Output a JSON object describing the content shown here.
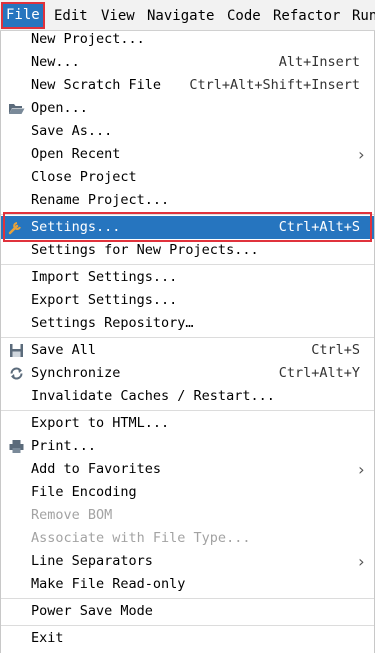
{
  "menubar": {
    "items": [
      {
        "label": "File",
        "mnemonic": "F",
        "active": true
      },
      {
        "label": "Edit"
      },
      {
        "label": "View"
      },
      {
        "label": "Navigate"
      },
      {
        "label": "Code"
      },
      {
        "label": "Refactor"
      },
      {
        "label": "Run"
      }
    ]
  },
  "menu": {
    "items": [
      {
        "label": "New Project..."
      },
      {
        "label": "New...",
        "shortcut": "Alt+Insert"
      },
      {
        "label": "New Scratch File",
        "shortcut": "Ctrl+Alt+Shift+Insert"
      },
      {
        "label": "Open...",
        "icon": "folder-open-icon"
      },
      {
        "label": "Save As..."
      },
      {
        "label": "Open Recent",
        "submenu": true
      },
      {
        "label": "Close Project"
      },
      {
        "label": "Rename Project..."
      },
      {
        "label": "Settings...",
        "shortcut": "Ctrl+Alt+S",
        "icon": "wrench-icon",
        "selected": true
      },
      {
        "label": "Settings for New Projects..."
      },
      {
        "label": "Import Settings..."
      },
      {
        "label": "Export Settings..."
      },
      {
        "label": "Settings Repository…"
      },
      {
        "label": "Save All",
        "shortcut": "Ctrl+S",
        "icon": "save-all-icon"
      },
      {
        "label": "Synchronize",
        "shortcut": "Ctrl+Alt+Y",
        "icon": "sync-icon"
      },
      {
        "label": "Invalidate Caches / Restart..."
      },
      {
        "label": "Export to HTML..."
      },
      {
        "label": "Print...",
        "icon": "printer-icon"
      },
      {
        "label": "Add to Favorites",
        "submenu": true
      },
      {
        "label": "File Encoding"
      },
      {
        "label": "Remove BOM",
        "disabled": true
      },
      {
        "label": "Associate with File Type...",
        "disabled": true
      },
      {
        "label": "Line Separators",
        "submenu": true
      },
      {
        "label": "Make File Read-only"
      },
      {
        "label": "Power Save Mode"
      },
      {
        "label": "Exit"
      }
    ],
    "submenu_arrow": "›"
  },
  "colors": {
    "selection": "#2675bf",
    "highlight_border": "#e0323c",
    "disabled_text": "#a3a3a3"
  }
}
